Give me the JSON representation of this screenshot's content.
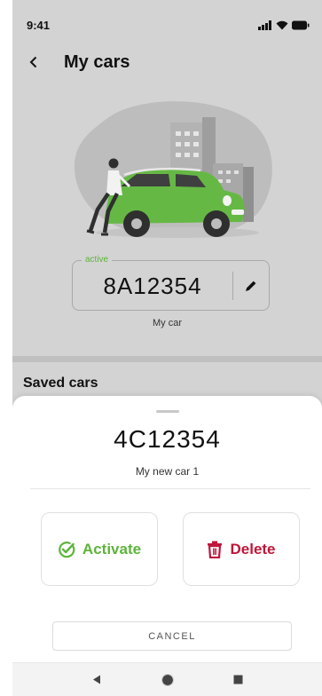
{
  "status": {
    "time": "9:41"
  },
  "header": {
    "title": "My cars",
    "back_icon": "chevron-left-icon"
  },
  "active_car": {
    "badge": "active",
    "plate": "8A12354",
    "name": "My car"
  },
  "saved_section": {
    "title": "Saved cars"
  },
  "sheet": {
    "plate": "4C12354",
    "name": "My new car 1",
    "activate_label": "Activate",
    "delete_label": "Delete",
    "cancel_label": "CANCEL"
  },
  "colors": {
    "accent_green": "#5db43b",
    "danger_red": "#c0163a",
    "background_grey": "#d3d3d3"
  }
}
